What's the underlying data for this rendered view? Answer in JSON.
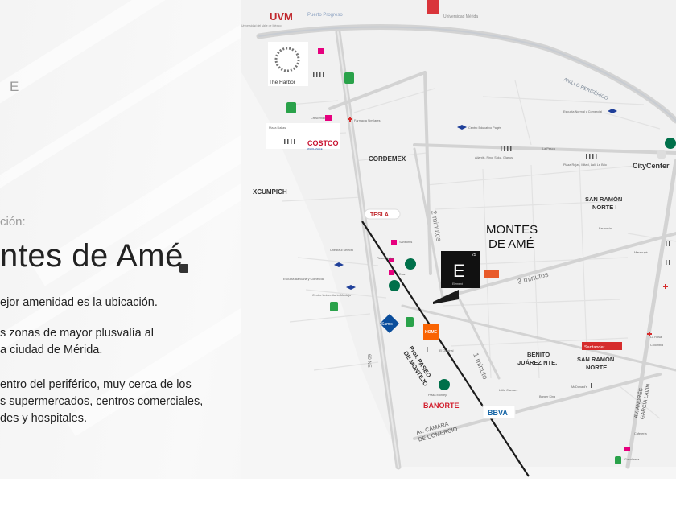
{
  "left_panel": {
    "corner_letter": "E",
    "subtitle": "ción:",
    "title": "ntes de Amé",
    "p1": "ejor amenidad es la ubicación.",
    "p2_l1": "s zonas de mayor plusvalía al",
    "p2_l2": "a ciudad de Mérida.",
    "p3_l1": "entro del periférico, muy cerca de los",
    "p3_l2": "s supermercados, centros comerciales,",
    "p3_l3": "des y hospitales."
  },
  "map": {
    "logos": {
      "uvm": "UVM",
      "uvm_sub": "Universidad del Valle de México",
      "anahuac_sub": "Universidad Mérida",
      "harbor": "The Harbor",
      "costco": "COSTCO",
      "costco_sub": "WHOLESALE",
      "citycenter": "CityCenter",
      "tesla": "TESLA",
      "sams": "Sam's",
      "homedepot": "HOME",
      "banorte": "BANORTE",
      "bbva": "BBVA",
      "santander": "Santander"
    },
    "zones": {
      "cordemex": "CORDEMEX",
      "xcumpich": "XCUMPICH",
      "san_ramon_norte_1_l1": "SAN RAMÓN",
      "san_ramon_norte_1_l2": "NORTE I",
      "benito_l1": "BENITO",
      "benito_l2": "JUÁREZ NTE.",
      "san_ramon_norte_l1": "SAN RAMÓN",
      "san_ramon_norte_l2": "NORTE"
    },
    "project": {
      "label_l1": "MONTES",
      "label_l2": "DE AMÉ",
      "logo_letter": "E",
      "logo_num": "25",
      "logo_sub": "Element"
    },
    "roads": {
      "puerto_progreso": "Puerto Progreso",
      "anillo": "ANILLO PERIFÉRICO",
      "prol_paseo_l1": "Prol. PASEO",
      "prol_paseo_l2": "DE MONTEJO",
      "av_camara_l1": "Av. CÁMARA",
      "av_camara_l2": "DE COMERCIO",
      "av_andres_l1": "AV. ANDRÉS",
      "av_andres_l2": "GARCÍA LAVIN",
      "calle60": "60 NE"
    },
    "times": {
      "t2": "2 minutos",
      "t3": "3 minutos",
      "t1": "1 minuto"
    },
    "pois": {
      "plaza_dalia": "Plaza Dalias",
      "crescent": "Crescendo",
      "farmacia": "Farmacia Similares",
      "centro_escolar": "Centro Educativo Pagés",
      "vivienda": "Atlantis, Pino, Suka, Glarius",
      "plaza_rejas": "Plaza Rejas, Mitad, Lali, Le Brio",
      "lapesca": "La Pesca",
      "univ_comercial": "Escuela Normal y Comercial",
      "sanborns": "Sanborns",
      "plaza_platino": "Plaza Platino",
      "diaz": "Diaz",
      "chedraui": "Chedraui Selecto",
      "escuela_banco": "Escuela Bancaria y Comercial",
      "centro_universitario": "Centro Universitario Montejo",
      "el_original": "El Original",
      "plaza_montejo": "Plaza Montejo",
      "little_caesars": "Little Caesars",
      "burger": "Burger King",
      "mcdonalds": "McDonald's",
      "maracuya": "Maracuyá",
      "la_rosa": "La Rosa",
      "colombia": "Colombia",
      "cafeteria": "Cafetería",
      "gasolinera": "Gasolinera",
      "farmacia2": "Farmacia"
    }
  }
}
